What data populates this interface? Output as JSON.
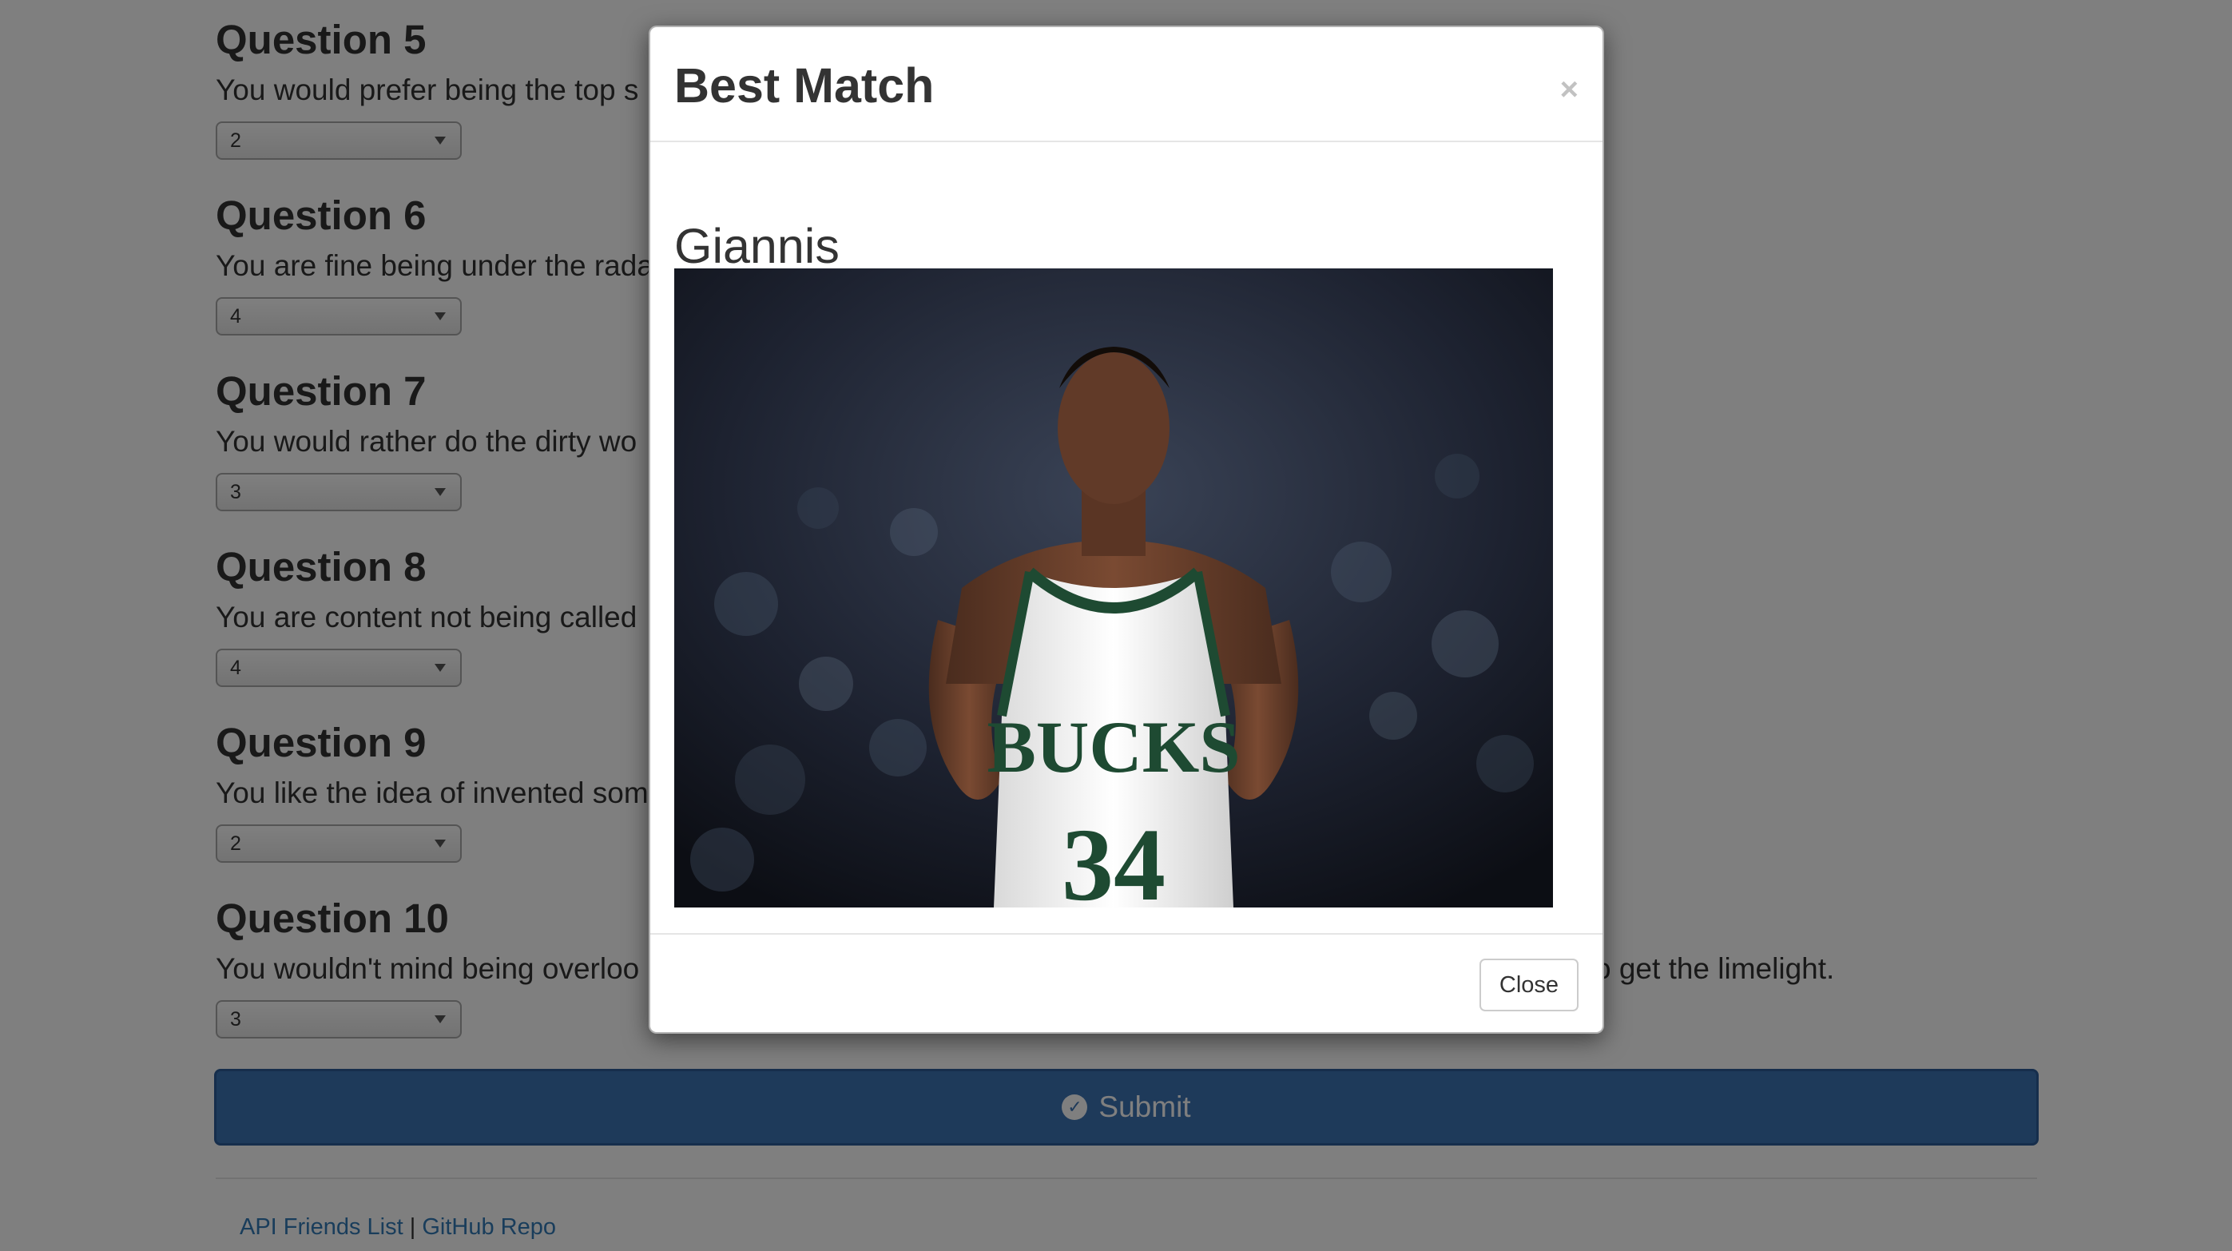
{
  "questions": [
    {
      "title": "Question 5",
      "text": "You would prefer being the top s",
      "value": "2"
    },
    {
      "title": "Question 6",
      "text": "You are fine being under the rada",
      "value": "4"
    },
    {
      "title": "Question 7",
      "text": "You would rather do the dirty wo",
      "value": "3"
    },
    {
      "title": "Question 8",
      "text": "You are content not being called",
      "value": "4"
    },
    {
      "title": "Question 9",
      "text": "You like the idea of invented som",
      "value": "2"
    },
    {
      "title": "Question 10",
      "text": "You wouldn't mind being overloo",
      "text_tail": "o get the limelight.",
      "value": "3"
    }
  ],
  "submit": {
    "label": "Submit",
    "icon": "check-circle-icon"
  },
  "footer": {
    "link_1": "API Friends List",
    "separator": "|",
    "link_2": "GitHub Repo"
  },
  "modal": {
    "title": "Best Match",
    "close_symbol": "×",
    "match_name": "Giannis",
    "photo_jersey_text": "BUCKS",
    "photo_jersey_number": "34",
    "close_button_label": "Close"
  },
  "colors": {
    "primary": "#3d74b5",
    "link": "#337ab7",
    "jersey_green": "#1e4a32"
  }
}
